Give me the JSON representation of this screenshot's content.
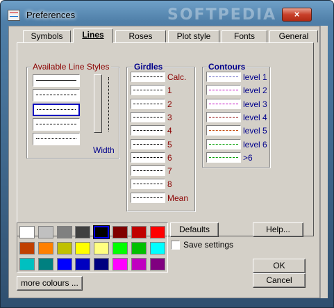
{
  "window": {
    "title": "Preferences",
    "watermark": "SOFTPEDIA",
    "close_glyph": "×"
  },
  "tabs": [
    "Symbols",
    "Lines",
    "Roses",
    "Plot style",
    "Fonts",
    "General"
  ],
  "active_tab": "Lines",
  "line_styles": {
    "title": "Available Line Styles",
    "width_label": "Width"
  },
  "girdles": {
    "title": "Girdles",
    "labels": [
      "Calc.",
      "1",
      "2",
      "3",
      "4",
      "5",
      "6",
      "7",
      "8",
      "Mean"
    ],
    "label_color": "#8b0000"
  },
  "contours": {
    "title": "Contours",
    "labels": [
      "level 1",
      "level 2",
      "level 3",
      "level 4",
      "level 5",
      "level 6",
      ">6"
    ],
    "line_colors": [
      "#6060c0",
      "#c000c0",
      "#c000c0",
      "#8b0000",
      "#c04000",
      "#00a000",
      "#00a000"
    ]
  },
  "palette": {
    "colors": [
      "#ffffff",
      "#c0c0c0",
      "#808080",
      "#404040",
      "#000000",
      "#800000",
      "#c00000",
      "#ff0000",
      "#c04000",
      "#ff8000",
      "#c0c000",
      "#ffff00",
      "#ffff80",
      "#00ff00",
      "#00c000",
      "#00ffff",
      "#00c0c0",
      "#008080",
      "#0000ff",
      "#0000c0",
      "#000080",
      "#ff00ff",
      "#c000c0",
      "#800080"
    ],
    "selected_index": 4
  },
  "buttons": {
    "defaults": "Defaults",
    "help": "Help...",
    "ok": "OK",
    "cancel": "Cancel",
    "more_colours": "more colours ..."
  },
  "save_settings": {
    "label": "Save settings",
    "checked": false
  }
}
